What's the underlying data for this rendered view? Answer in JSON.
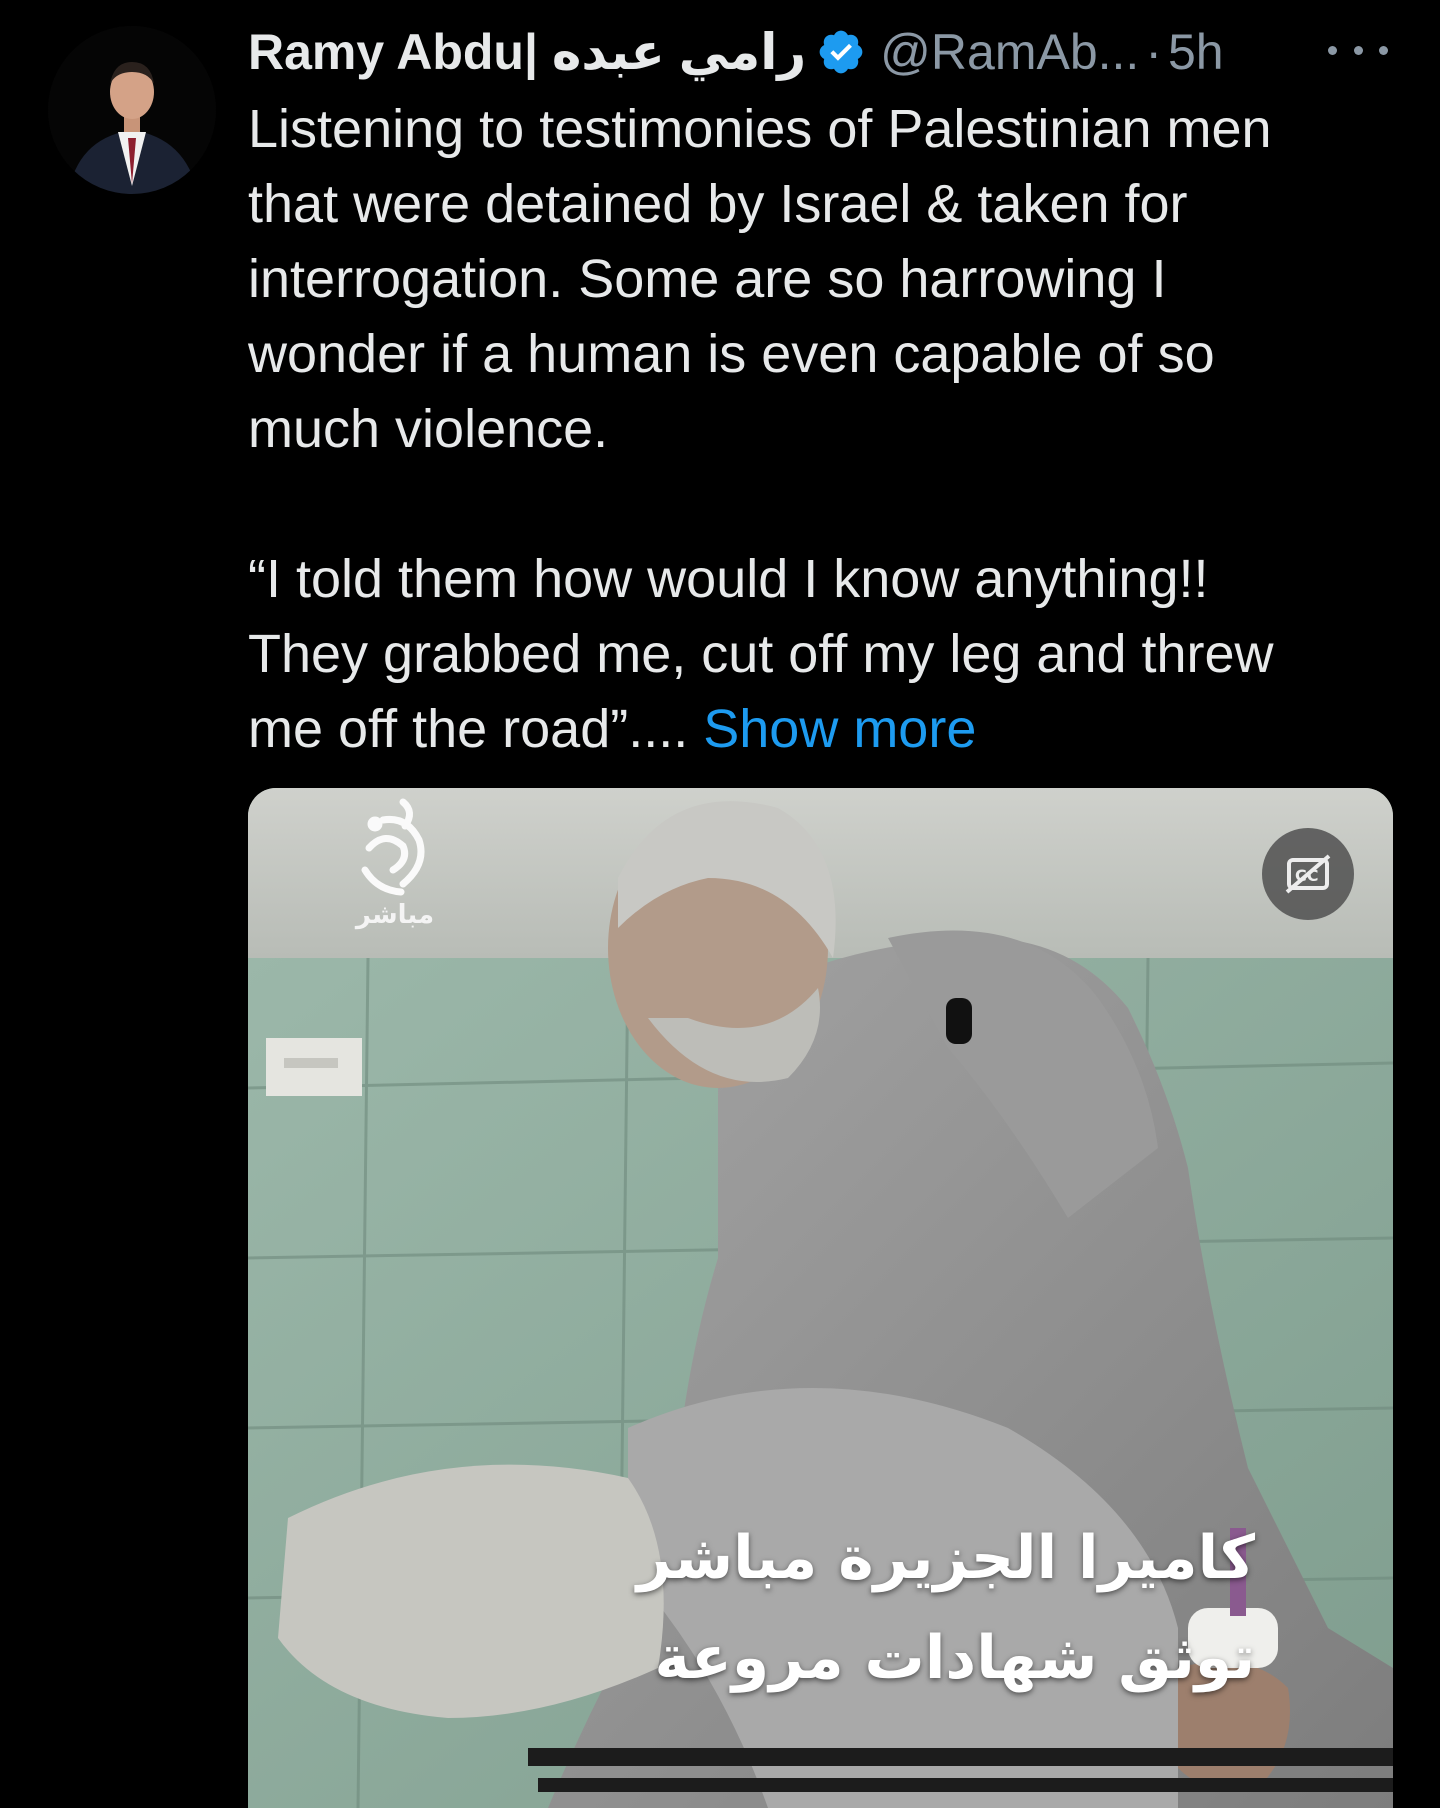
{
  "tweet": {
    "author": {
      "display_name": "Ramy Abdu| رامي عبده",
      "verified": true,
      "handle": "@RamAb...",
      "separator": "·",
      "timestamp": "5h"
    },
    "more_icon": "more-horizontal-icon",
    "text_paragraph_1": "Listening to testimonies of Palestinian men\nthat were detained by Israel & taken for\ninterrogation. Some are so harrowing I\nwonder if a human is even capable of so\nmuch violence.",
    "text_paragraph_2": "“I told them how would I know anything!!\nThey grabbed me, cut off my leg and threw\nme off the road”.... ",
    "show_more_label": "Show more",
    "media": {
      "channel_logo_caption": "مباشر",
      "caption_toggle_icon": "closed-captions-off-icon",
      "overlay_line_1": "كاميرا الجزيرة مباشر",
      "overlay_line_2": "توثق شهادات مروعة"
    },
    "colors": {
      "background": "#000000",
      "text": "#e7e9ea",
      "secondary_text": "#8b98a5",
      "link": "#1d9bf0",
      "verified_badge": "#1d9bf0"
    }
  }
}
